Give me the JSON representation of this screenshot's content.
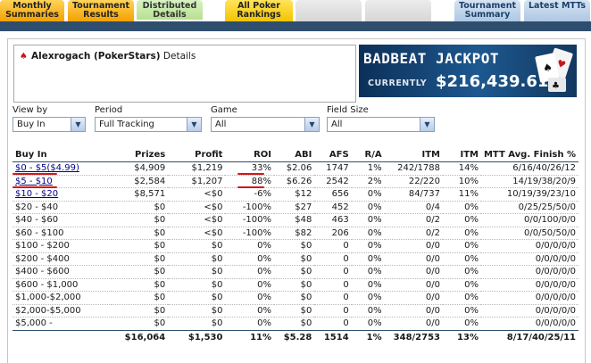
{
  "tabs": [
    {
      "label": "Monthly Summaries"
    },
    {
      "label": "Tournament Results"
    },
    {
      "label": "Distributed Details"
    },
    {
      "label": "All Poker Rankings"
    },
    {
      "label": ""
    },
    {
      "label": ""
    },
    {
      "label": "Tournament Summary"
    },
    {
      "label": "Latest MTTs"
    }
  ],
  "user": {
    "name": "Alexrogach (PokerStars)",
    "suffix": "Details",
    "icon": "pokerstars-spade-icon"
  },
  "banner": {
    "title": "BADBEAT JACKPOT",
    "label": "CURRENTLY",
    "amount": "$216,439.61"
  },
  "filters": [
    {
      "label": "View by",
      "value": "Buy In"
    },
    {
      "label": "Period",
      "value": "Full Tracking"
    },
    {
      "label": "Game",
      "value": "All"
    },
    {
      "label": "Field Size",
      "value": "All"
    }
  ],
  "table": {
    "headers": [
      "Buy In",
      "Prizes",
      "Profit",
      "ROI",
      "ABI",
      "AFS",
      "R/A",
      "ITM",
      "ITM",
      "MTT Avg. Finish %"
    ],
    "rows": [
      [
        "$0 - $5($4.99)",
        "$4,909",
        "$1,219",
        "33%",
        "$2.06",
        "1747",
        "1%",
        "242/1788",
        "14%",
        "6/16/40/26/12"
      ],
      [
        "$5 - $10",
        "$2,584",
        "$1,207",
        "88%",
        "$6.26",
        "2542",
        "2%",
        "22/220",
        "10%",
        "14/19/38/20/9"
      ],
      [
        "$10 - $20",
        "$8,571",
        "<$0",
        "-6%",
        "$12",
        "656",
        "0%",
        "84/737",
        "11%",
        "10/19/39/23/10"
      ],
      [
        "$20 - $40",
        "$0",
        "<$0",
        "-100%",
        "$27",
        "452",
        "0%",
        "0/4",
        "0%",
        "0/25/25/50/0"
      ],
      [
        "$40 - $60",
        "$0",
        "<$0",
        "-100%",
        "$48",
        "463",
        "0%",
        "0/2",
        "0%",
        "0/0/100/0/0"
      ],
      [
        "$60 - $100",
        "$0",
        "<$0",
        "-100%",
        "$82",
        "206",
        "0%",
        "0/2",
        "0%",
        "0/0/50/50/0"
      ],
      [
        "$100 - $200",
        "$0",
        "$0",
        "0%",
        "$0",
        "0",
        "0%",
        "0/0",
        "0%",
        "0/0/0/0/0"
      ],
      [
        "$200 - $400",
        "$0",
        "$0",
        "0%",
        "$0",
        "0",
        "0%",
        "0/0",
        "0%",
        "0/0/0/0/0"
      ],
      [
        "$400 - $600",
        "$0",
        "$0",
        "0%",
        "$0",
        "0",
        "0%",
        "0/0",
        "0%",
        "0/0/0/0/0"
      ],
      [
        "$600 - $1,000",
        "$0",
        "$0",
        "0%",
        "$0",
        "0",
        "0%",
        "0/0",
        "0%",
        "0/0/0/0/0"
      ],
      [
        "$1,000-$2,000",
        "$0",
        "$0",
        "0%",
        "$0",
        "0",
        "0%",
        "0/0",
        "0%",
        "0/0/0/0/0"
      ],
      [
        "$2,000-$5,000",
        "$0",
        "$0",
        "0%",
        "$0",
        "0",
        "0%",
        "0/0",
        "0%",
        "0/0/0/0/0"
      ],
      [
        "$5,000 -",
        "$0",
        "$0",
        "0%",
        "$0",
        "0",
        "0%",
        "0/0",
        "0%",
        "0/0/0/0/0"
      ]
    ],
    "totals": [
      "",
      "$16,064",
      "$1,530",
      "11%",
      "$5.28",
      "1514",
      "1%",
      "348/2753",
      "13%",
      "8/17/40/25/11"
    ]
  }
}
